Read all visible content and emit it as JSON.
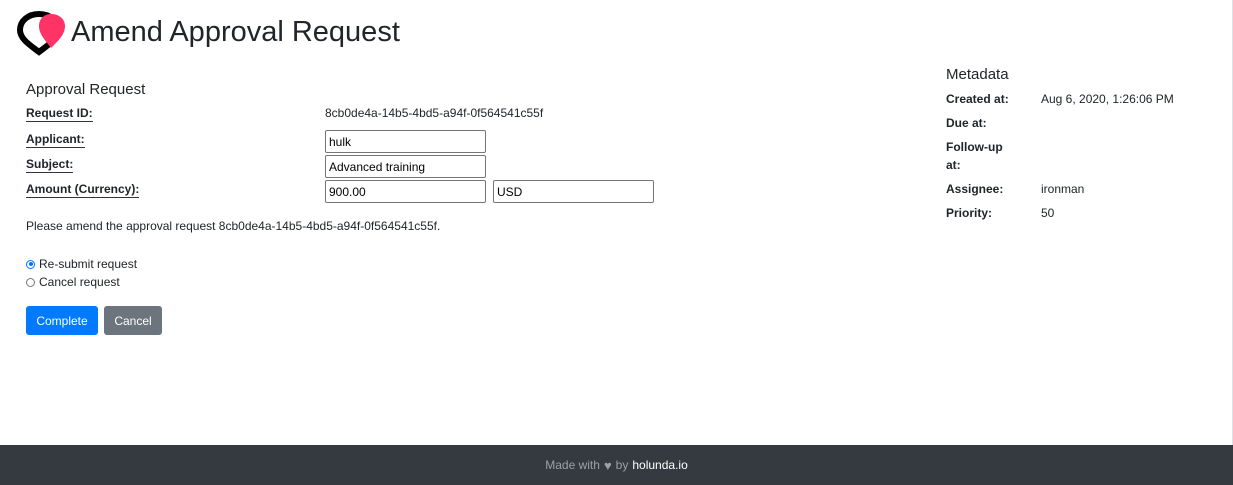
{
  "header": {
    "title": "Amend Approval Request",
    "logo_icon": "holunda-logo-icon",
    "colors": {
      "logo_dark": "#000000",
      "logo_accent": "#ff3366"
    }
  },
  "form": {
    "section_title": "Approval Request",
    "fields": {
      "request_id": {
        "label": "Request ID:",
        "value": "8cb0de4a-14b5-4bd5-a94f-0f564541c55f"
      },
      "applicant": {
        "label": "Applicant:",
        "value": "hulk"
      },
      "subject": {
        "label": "Subject:",
        "value": "Advanced training"
      },
      "amount": {
        "label": "Amount (Currency):",
        "value": "900.00",
        "currency": "USD"
      }
    },
    "message": "Please amend the approval request 8cb0de4a-14b5-4bd5-a94f-0f564541c55f.",
    "options": [
      {
        "label": "Re-submit request",
        "checked": true
      },
      {
        "label": "Cancel request",
        "checked": false
      }
    ],
    "buttons": {
      "complete": "Complete",
      "cancel": "Cancel"
    },
    "colors": {
      "primary": "#007bff",
      "secondary": "#6c757d"
    }
  },
  "metadata": {
    "title": "Metadata",
    "created_label": "Created at:",
    "created_value": "Aug 6, 2020, 1:26:06 PM",
    "due_label": "Due at:",
    "due_value": "",
    "followup_label_1": "Follow-up",
    "followup_label_2": "at:",
    "followup_value": "",
    "assignee_label": "Assignee:",
    "assignee_value": "ironman",
    "priority_label": "Priority:",
    "priority_value": "50"
  },
  "footer": {
    "made_with": "Made with",
    "heart_icon": "heart-icon",
    "by": "by",
    "brand": "holunda.io",
    "background": "#343a40"
  }
}
